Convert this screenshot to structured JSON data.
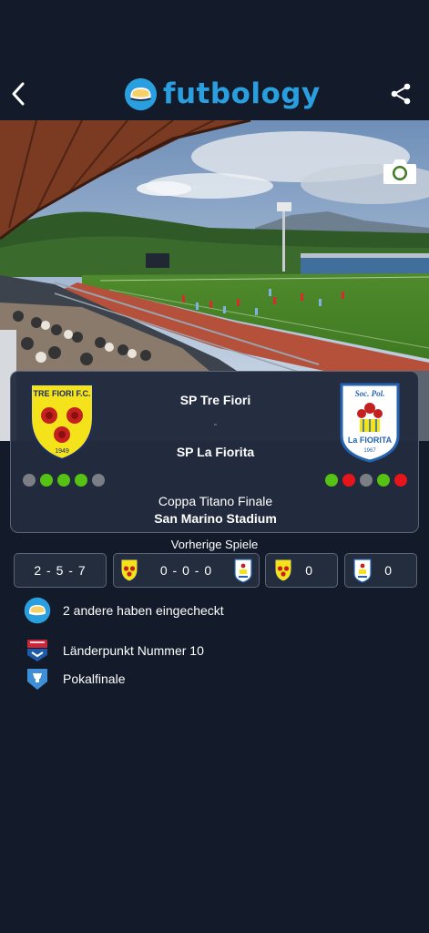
{
  "header": {
    "brand": "futbology",
    "back_icon": "chevron-left-icon",
    "share_icon": "share-icon",
    "accent": "#2a9fdf"
  },
  "match": {
    "home_team": "SP Tre Fiori",
    "separator": "-",
    "away_team": "SP La Fiorita",
    "home_crest": {
      "top_text": "TRE FIORI F.C.",
      "year": "1949",
      "color": "#f4e21a"
    },
    "away_crest": {
      "top_text": "Soc. Pol.",
      "name": "La FIORITA",
      "year": "1967",
      "color": "#2563b0"
    },
    "home_form": [
      "D",
      "W",
      "W",
      "W",
      "D"
    ],
    "away_form": [
      "W",
      "L",
      "D",
      "W",
      "L"
    ],
    "form_colors": {
      "W": "#55c214",
      "L": "#e5151b",
      "D": "#7b7f85"
    },
    "competition": "Coppa Titano Finale",
    "venue": "San Marino Stadium"
  },
  "previous": {
    "title": "Vorherige Spiele",
    "record": "2 - 5 - 7",
    "head_to_head": "0 - 0 - 0",
    "home_count": "0",
    "away_count": "0"
  },
  "features": {
    "checkins": "2 andere haben eingecheckt",
    "country_point": "Länderpunkt Nummer 10",
    "cup_final": "Pokalfinale"
  }
}
